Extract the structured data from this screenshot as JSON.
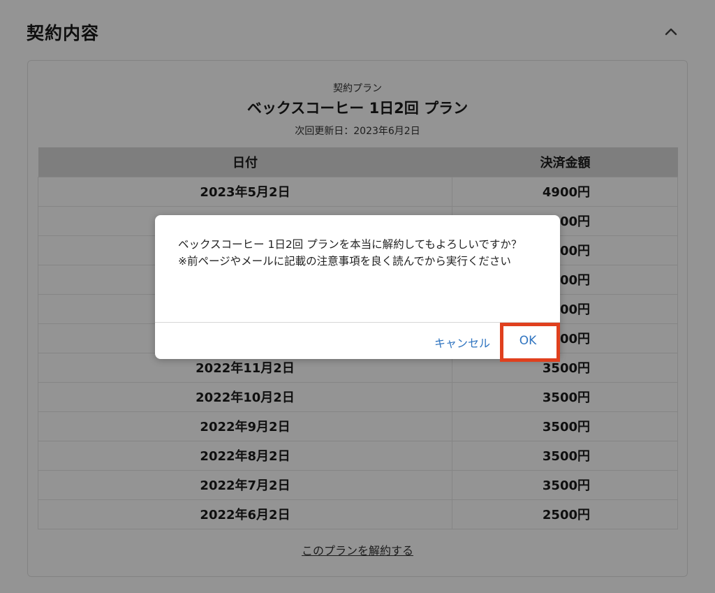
{
  "section": {
    "title": "契約内容",
    "toggle_icon": "chevron-up-icon"
  },
  "plan": {
    "caption": "契約プラン",
    "name": "ベックスコーヒー 1日2回 プラン",
    "next_renewal": "次回更新日：2023年6月2日"
  },
  "history": {
    "headers": [
      "日付",
      "決済金額"
    ],
    "rows": [
      [
        "2023年5月2日",
        "4900円"
      ],
      [
        "",
        "00円"
      ],
      [
        "",
        "00円"
      ],
      [
        "",
        "00円"
      ],
      [
        "",
        "00円"
      ],
      [
        "",
        "00円"
      ],
      [
        "2022年11月2日",
        "3500円"
      ],
      [
        "2022年10月2日",
        "3500円"
      ],
      [
        "2022年9月2日",
        "3500円"
      ],
      [
        "2022年8月2日",
        "3500円"
      ],
      [
        "2022年7月2日",
        "3500円"
      ],
      [
        "2022年6月2日",
        "2500円"
      ]
    ]
  },
  "cancel_link": "このプランを解約する",
  "dialog": {
    "message": "ベックスコーヒー 1日2回 プランを本当に解約してもよろしいですか？\n※前ページやメールに記載の注意事項を良く読んでから実行ください",
    "cancel_label": "キャンセル",
    "ok_label": "OK"
  },
  "colors": {
    "accent": "#2f74c0",
    "highlight": "#e0401e"
  }
}
